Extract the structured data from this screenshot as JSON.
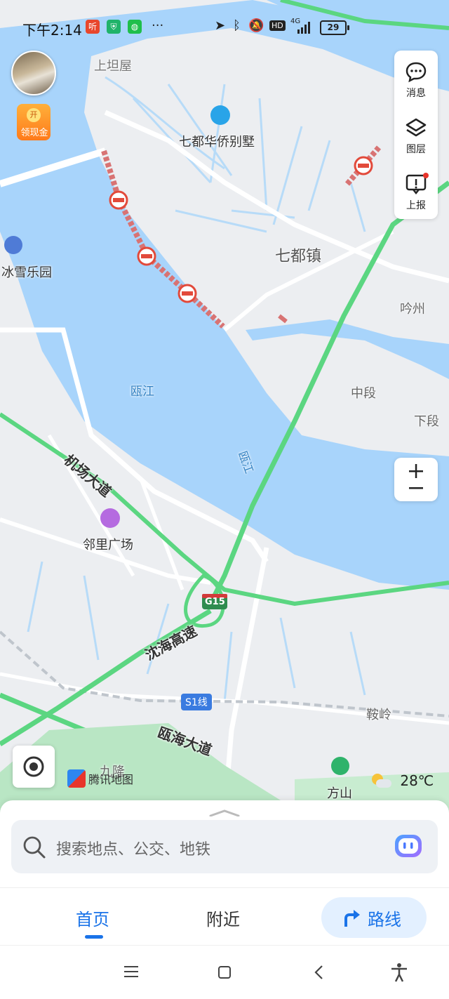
{
  "status_bar": {
    "time": "下午2:14",
    "app_icons": [
      "听",
      "shield",
      "wechat",
      "···"
    ],
    "network": "HD",
    "signal_type": "4G",
    "battery": "29"
  },
  "map": {
    "labels": {
      "shangtanwu": "上坦屋",
      "villa": "七都华侨别墅",
      "qidu_town": "七都镇",
      "yinzhou": "吟州",
      "bingxue": "冰雪乐园",
      "oujiang_1": "瓯江",
      "oujiang_2": "瓯江",
      "zhongduan": "中段",
      "xiaduan": "下段",
      "airport_road": "机场大道",
      "linli_plaza": "邻里广场",
      "g15": "G15",
      "shenhai_expressway": "沈海高速",
      "s1_line": "S1线",
      "anling": "鞍岭",
      "ouhai_avenue": "瓯海大道",
      "jiulong": "九隆",
      "fangshan": "方山"
    },
    "brand": "腾讯地图",
    "temperature": "28℃"
  },
  "toolbar": {
    "messages": "消息",
    "layers": "图层",
    "report": "上报"
  },
  "cash_widget": {
    "coin": "开",
    "label": "领现金"
  },
  "search": {
    "placeholder": "搜索地点、公交、地铁"
  },
  "tabs": {
    "home": "首页",
    "nearby": "附近",
    "route": "路线"
  },
  "colors": {
    "accent": "#1a73e8",
    "water": "#a8d4fb",
    "road_green": "#5bd681",
    "closure_red": "#e24a3b"
  }
}
